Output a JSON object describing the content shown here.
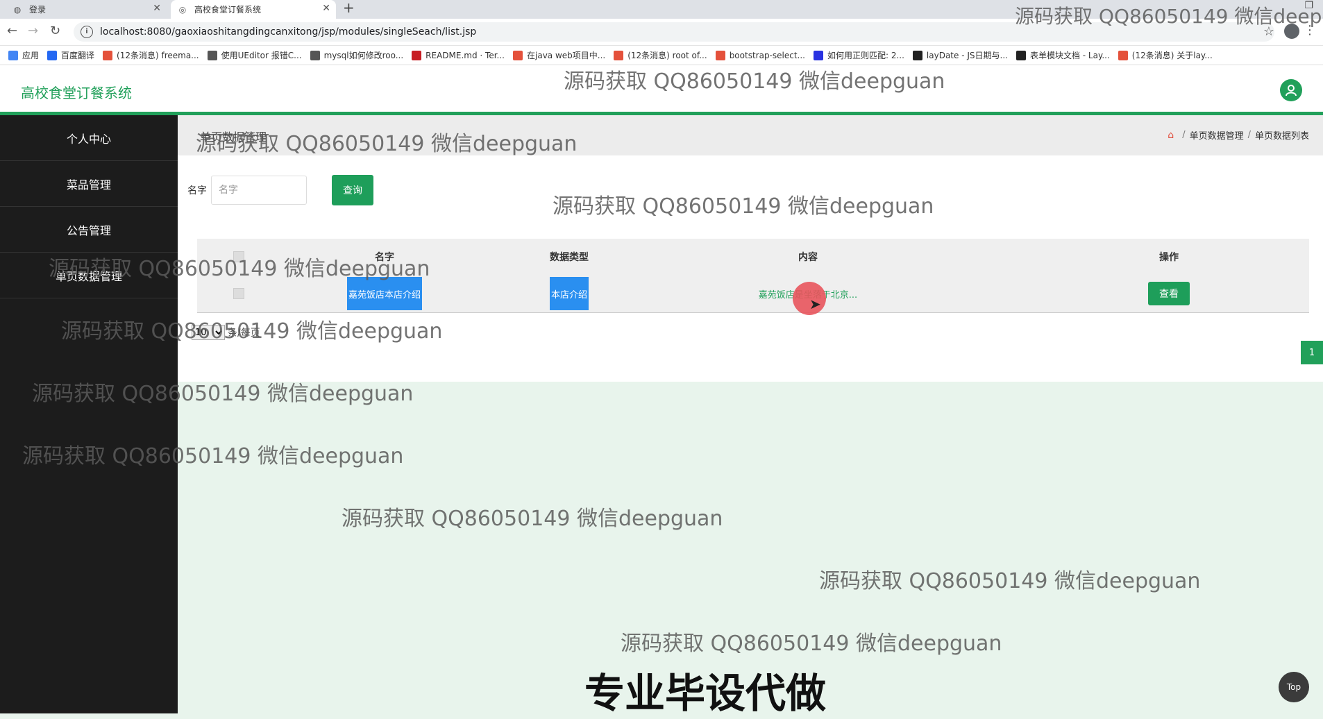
{
  "browser": {
    "tabs": [
      {
        "label": "登录",
        "active": false
      },
      {
        "label": "高校食堂订餐系统",
        "active": true
      }
    ],
    "url": "localhost:8080/gaoxiaoshitangdingcanxitong/jsp/modules/singleSeach/list.jsp",
    "bookmarks": [
      {
        "label": "应用",
        "icon": "apps-icon",
        "color": "#4285f4"
      },
      {
        "label": "百度翻译",
        "icon": "baidu-translate-icon",
        "color": "#2468f2"
      },
      {
        "label": "(12条消息) freema...",
        "icon": "csdn-icon",
        "color": "#e4513b"
      },
      {
        "label": "使用UEditor 报错C...",
        "icon": "leaf-icon",
        "color": "#555"
      },
      {
        "label": "mysql如何修改roo...",
        "icon": "leaf-icon",
        "color": "#555"
      },
      {
        "label": "README.md · Ter...",
        "icon": "gitee-icon",
        "color": "#c71d23"
      },
      {
        "label": "在java web项目中...",
        "icon": "csdn-icon",
        "color": "#e4513b"
      },
      {
        "label": "(12条消息) root of...",
        "icon": "csdn-icon",
        "color": "#e4513b"
      },
      {
        "label": "bootstrap-select...",
        "icon": "cnblogs-icon",
        "color": "#e4513b"
      },
      {
        "label": "如何用正则匹配: 2...",
        "icon": "baidu-paw-icon",
        "color": "#2932e1"
      },
      {
        "label": "layDate - JS日期与...",
        "icon": "layui-icon",
        "color": "#222"
      },
      {
        "label": "表单模块文档 - Lay...",
        "icon": "layui-icon",
        "color": "#222"
      },
      {
        "label": "(12条消息) 关于lay...",
        "icon": "csdn-icon",
        "color": "#e4513b"
      }
    ]
  },
  "app": {
    "title": "高校食堂订餐系统",
    "accent": "#21a05a"
  },
  "sidebar": {
    "items": [
      {
        "label": "个人中心"
      },
      {
        "label": "菜品管理"
      },
      {
        "label": "公告管理"
      },
      {
        "label": "单页数据管理"
      }
    ]
  },
  "page": {
    "title": "单页数据管理",
    "breadcrumb": [
      "单页数据管理",
      "单页数据列表"
    ]
  },
  "search": {
    "label": "名字",
    "placeholder": "名字",
    "button": "查询"
  },
  "table": {
    "columns": [
      "名字",
      "数据类型",
      "内容",
      "操作"
    ],
    "rows": [
      {
        "name": "嘉苑饭店本店介绍",
        "type": "本店介绍",
        "content": "嘉苑饭店是坐落于北京...",
        "action": "查看"
      }
    ]
  },
  "pagination": {
    "page_size": "10",
    "page_size_suffix": "条/每页",
    "current_page": "1"
  },
  "top_button": "Top",
  "watermark": {
    "text": "源码获取 QQ86050149 微信deepguan",
    "banner": "专业毕设代做"
  }
}
